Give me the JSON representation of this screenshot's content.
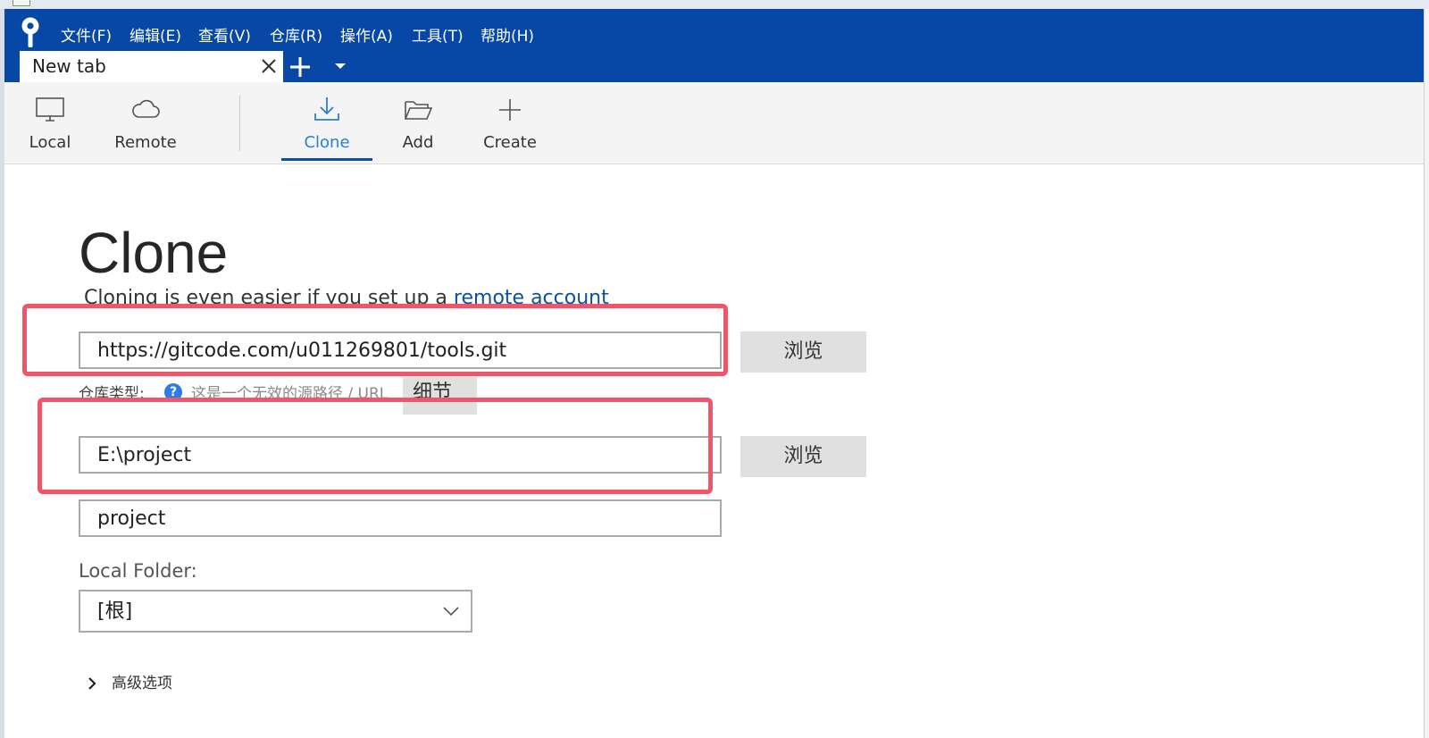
{
  "menu": {
    "items": [
      {
        "label": "文件(F)"
      },
      {
        "label": "编辑(E)"
      },
      {
        "label": "查看(V)"
      },
      {
        "label": "仓库(R)"
      },
      {
        "label": "操作(A)"
      },
      {
        "label": "工具(T)"
      },
      {
        "label": "帮助(H)"
      }
    ]
  },
  "tabs": {
    "active_label": "New tab",
    "close_icon": "close-icon",
    "add_icon": "plus-icon",
    "dropdown_icon": "chevron-down-icon"
  },
  "toolbar": {
    "items": [
      {
        "label": "Local",
        "icon": "monitor-icon"
      },
      {
        "label": "Remote",
        "icon": "cloud-icon"
      },
      {
        "label": "Clone",
        "icon": "download-tray-icon",
        "active": true
      },
      {
        "label": "Add",
        "icon": "folder-open-icon"
      },
      {
        "label": "Create",
        "icon": "plus-icon"
      }
    ]
  },
  "clone": {
    "title": "Clone",
    "hint_text": "Cloning is even easier if you set up a ",
    "hint_link": "remote account",
    "source_url": "https://gitcode.com/u011269801/tools.git",
    "browse_label": "浏览",
    "repo_type_label": "仓库类型:",
    "repo_type_help": "?",
    "repo_type_status": "这是一个无效的源路径 / URL",
    "details_label": "细节",
    "destination_path": "E:\\project",
    "name": "project",
    "local_folder_label": "Local Folder:",
    "local_folder_value": "[根]",
    "advanced_label": "高级选项"
  },
  "colors": {
    "titlebar": "#0747a6",
    "accent": "#2a7fd4",
    "annotation": "#f0566a",
    "toolbar_bg": "#f4f4f4",
    "button_bg": "#e0e0e0"
  }
}
